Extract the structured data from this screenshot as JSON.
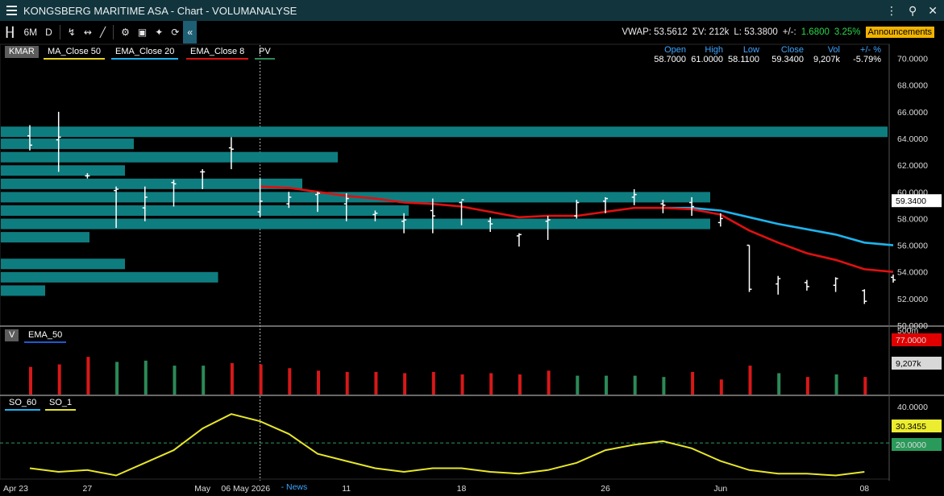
{
  "window": {
    "title": "KONGSBERG MARITIME ASA - Chart - VOLUMANALYSE"
  },
  "toolbar": {
    "period": "6M",
    "interval": "D",
    "collapse": "«"
  },
  "stats": {
    "vwap": "VWAP: 53.5612",
    "sumv": "ΣV: 212k",
    "last": "L: 53.3800",
    "chg_label": "+/-:",
    "chg": "1.6800",
    "chg_pct": "3.25%",
    "announcements": "Announcements"
  },
  "legend": {
    "symbol": "KMAR",
    "ma50": "MA_Close 50",
    "ema20": "EMA_Close 20",
    "ema8": "EMA_Close 8",
    "pv": "PV",
    "vol": "V",
    "vol_ema": "EMA_50",
    "so60": "SO_60",
    "so1": "SO_1"
  },
  "ohlc": {
    "headers": [
      "Open",
      "High",
      "Low",
      "Close",
      "Vol",
      "+/- %"
    ],
    "values": [
      "58.7000",
      "61.0000",
      "58.1100",
      "59.3400",
      "9,207k",
      "-5.79%"
    ]
  },
  "colors": {
    "ema20": "#1eb4ee",
    "ema8": "#e01010",
    "ma50": "#e6d320",
    "pv_bar": "#0e7d80",
    "vol_up": "#2c8a58",
    "vol_down": "#d81818",
    "so": "#e6e62a",
    "accent": "#f2b300"
  },
  "chart_data": [
    {
      "type": "ohlc",
      "ylim": [
        50,
        71
      ],
      "ytick_labels": [
        "50.0000",
        "52.0000",
        "54.0000",
        "56.0000",
        "58.0000",
        "60.0000",
        "62.0000",
        "64.0000",
        "66.0000",
        "68.0000",
        "70.0000"
      ],
      "ytick_values": [
        50,
        52,
        54,
        56,
        58,
        60,
        62,
        64,
        66,
        68,
        70
      ],
      "last_price_label": "59.3400",
      "last_price": 59.34,
      "xtick_labels": [
        "Apr 23",
        "27",
        "May",
        "06 May 2026",
        "11",
        "18",
        "26",
        "Jun",
        "08"
      ],
      "xtick_index": [
        0,
        2,
        6,
        7.5,
        11,
        15,
        20,
        24,
        29
      ],
      "cursor_index": 8,
      "cursor_tag": "News",
      "bars": [
        {
          "o": 64.2,
          "h": 65.0,
          "l": 63.1,
          "c": 63.5
        },
        {
          "o": 63.9,
          "h": 66.0,
          "l": 61.5,
          "c": 64.1
        },
        {
          "o": 61.2,
          "h": 61.4,
          "l": 61.0,
          "c": 61.2
        },
        {
          "o": 60.1,
          "h": 60.4,
          "l": 57.3,
          "c": 60.2
        },
        {
          "o": 58.8,
          "h": 60.4,
          "l": 57.8,
          "c": 59.6
        },
        {
          "o": 60.7,
          "h": 60.9,
          "l": 58.9,
          "c": 60.6
        },
        {
          "o": 61.5,
          "h": 61.7,
          "l": 60.2,
          "c": 61.5
        },
        {
          "o": 63.3,
          "h": 64.1,
          "l": 61.7,
          "c": 63.2
        },
        {
          "o": 58.5,
          "h": 61.0,
          "l": 58.1,
          "c": 59.3
        },
        {
          "o": 59.1,
          "h": 60.0,
          "l": 58.8,
          "c": 59.6
        },
        {
          "o": 59.8,
          "h": 60.0,
          "l": 58.5,
          "c": 59.9
        },
        {
          "o": 59.1,
          "h": 59.9,
          "l": 57.8,
          "c": 59.5
        },
        {
          "o": 58.3,
          "h": 58.6,
          "l": 57.8,
          "c": 58.4
        },
        {
          "o": 57.8,
          "h": 58.4,
          "l": 56.9,
          "c": 57.9
        },
        {
          "o": 58.6,
          "h": 59.5,
          "l": 56.9,
          "c": 58.2
        },
        {
          "o": 59.2,
          "h": 59.3,
          "l": 57.5,
          "c": 59.4
        },
        {
          "o": 57.8,
          "h": 58.1,
          "l": 57.0,
          "c": 57.6
        },
        {
          "o": 56.7,
          "h": 56.9,
          "l": 55.9,
          "c": 56.8
        },
        {
          "o": 57.8,
          "h": 58.2,
          "l": 56.4,
          "c": 57.9
        },
        {
          "o": 58.2,
          "h": 59.4,
          "l": 58.0,
          "c": 59.2
        },
        {
          "o": 59.3,
          "h": 59.6,
          "l": 58.4,
          "c": 59.5
        },
        {
          "o": 59.6,
          "h": 60.2,
          "l": 59.0,
          "c": 59.8
        },
        {
          "o": 59.1,
          "h": 59.4,
          "l": 58.4,
          "c": 59.0
        },
        {
          "o": 59.2,
          "h": 59.6,
          "l": 58.2,
          "c": 58.9
        },
        {
          "o": 57.7,
          "h": 58.4,
          "l": 57.4,
          "c": 58.0
        },
        {
          "o": 56.0,
          "h": 56.0,
          "l": 52.5,
          "c": 52.7
        },
        {
          "o": 53.1,
          "h": 53.7,
          "l": 52.3,
          "c": 53.5
        },
        {
          "o": 53.2,
          "h": 53.4,
          "l": 52.6,
          "c": 52.9
        },
        {
          "o": 53.0,
          "h": 53.6,
          "l": 52.5,
          "c": 53.5
        },
        {
          "o": 52.6,
          "h": 52.7,
          "l": 51.6,
          "c": 51.8
        },
        {
          "o": 53.6,
          "h": 53.8,
          "l": 53.2,
          "c": 53.4
        }
      ],
      "series": [
        {
          "name": "EMA_Close 20",
          "values": [
            null,
            null,
            null,
            null,
            null,
            null,
            null,
            null,
            null,
            null,
            null,
            null,
            null,
            null,
            null,
            null,
            null,
            null,
            null,
            null,
            null,
            null,
            58.8,
            58.8,
            58.6,
            58.1,
            57.6,
            57.2,
            56.8,
            56.2,
            56.0
          ]
        },
        {
          "name": "EMA_Close 8",
          "values": [
            null,
            null,
            null,
            null,
            null,
            null,
            null,
            null,
            60.4,
            60.3,
            60.0,
            59.7,
            59.5,
            59.2,
            59.1,
            58.9,
            58.5,
            58.1,
            58.2,
            58.2,
            58.5,
            58.8,
            58.8,
            58.7,
            58.3,
            57.1,
            56.2,
            55.4,
            54.9,
            54.2,
            54.0
          ]
        }
      ],
      "volume_profile": [
        {
          "price": 64.5,
          "volume": 100
        },
        {
          "price": 63.6,
          "volume": 15
        },
        {
          "price": 62.6,
          "volume": 38
        },
        {
          "price": 61.6,
          "volume": 14
        },
        {
          "price": 60.6,
          "volume": 34
        },
        {
          "price": 59.6,
          "volume": 80
        },
        {
          "price": 58.6,
          "volume": 46
        },
        {
          "price": 57.6,
          "volume": 80
        },
        {
          "price": 56.6,
          "volume": 10
        },
        {
          "price": 54.6,
          "volume": 14
        },
        {
          "price": 53.6,
          "volume": 24.5
        },
        {
          "price": 52.6,
          "volume": 5
        }
      ]
    },
    {
      "type": "bar",
      "title": "V",
      "ylim": [
        0,
        500
      ],
      "top_label": "500m",
      "ema_label": "77.0000",
      "last_label": "9,207k",
      "values": [
        220,
        240,
        300,
        260,
        270,
        230,
        230,
        250,
        240,
        210,
        190,
        180,
        180,
        170,
        180,
        160,
        170,
        160,
        190,
        150,
        150,
        150,
        140,
        180,
        120,
        230,
        170,
        140,
        160,
        140
      ],
      "direction": [
        "d",
        "d",
        "d",
        "u",
        "u",
        "u",
        "u",
        "d",
        "d",
        "d",
        "d",
        "d",
        "d",
        "d",
        "d",
        "d",
        "d",
        "d",
        "d",
        "u",
        "u",
        "u",
        "u",
        "d",
        "d",
        "d",
        "u",
        "d",
        "u",
        "d"
      ]
    },
    {
      "type": "line",
      "title": "SO",
      "ylim": [
        0,
        45
      ],
      "ytick_labels": [
        "40.0000",
        "20.0000"
      ],
      "ytick_values": [
        40,
        20
      ],
      "last_label": "30.3455",
      "reference_label": "20.0000",
      "reference": 20,
      "series": [
        {
          "name": "SO_1",
          "values": [
            6,
            4,
            5,
            2,
            9,
            16,
            28,
            36,
            32,
            25,
            14,
            10,
            6,
            4,
            6,
            6,
            4,
            3,
            5,
            9,
            16,
            19,
            21,
            17,
            10,
            5,
            3,
            3,
            2,
            4
          ]
        }
      ]
    }
  ]
}
